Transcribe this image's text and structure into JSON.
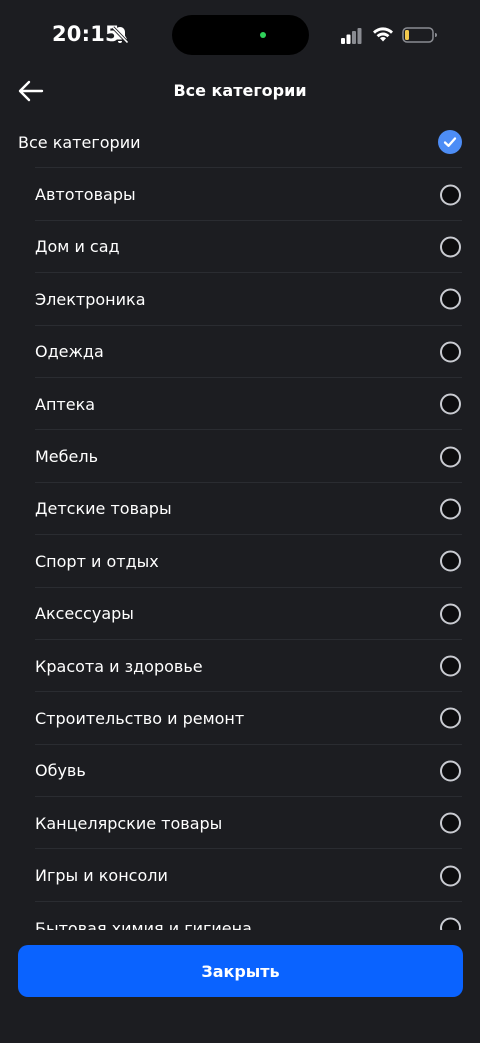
{
  "status_bar": {
    "time": "20:15",
    "icons": [
      "bell-slash-icon",
      "signal-icon",
      "wifi-icon",
      "battery-icon"
    ]
  },
  "header": {
    "title": "Все категории",
    "back_icon": "arrow-left-icon"
  },
  "all_item": {
    "label": "Все категории",
    "selected": true
  },
  "categories": [
    {
      "label": "Автотовары",
      "selected": false
    },
    {
      "label": "Дом и сад",
      "selected": false
    },
    {
      "label": "Электроника",
      "selected": false
    },
    {
      "label": "Одежда",
      "selected": false
    },
    {
      "label": "Аптека",
      "selected": false
    },
    {
      "label": "Мебель",
      "selected": false
    },
    {
      "label": "Детские товары",
      "selected": false
    },
    {
      "label": "Спорт и отдых",
      "selected": false
    },
    {
      "label": "Аксессуары",
      "selected": false
    },
    {
      "label": "Красота и здоровье",
      "selected": false
    },
    {
      "label": "Строительство и ремонт",
      "selected": false
    },
    {
      "label": "Обувь",
      "selected": false
    },
    {
      "label": "Канцелярские товары",
      "selected": false
    },
    {
      "label": "Игры и консоли",
      "selected": false
    },
    {
      "label": "Бытовая химия и гигиена",
      "selected": false
    }
  ],
  "footer": {
    "close_label": "Закрыть"
  },
  "colors": {
    "background": "#1c1d21",
    "accent": "#0a63ff",
    "check": "#4d8df6"
  }
}
